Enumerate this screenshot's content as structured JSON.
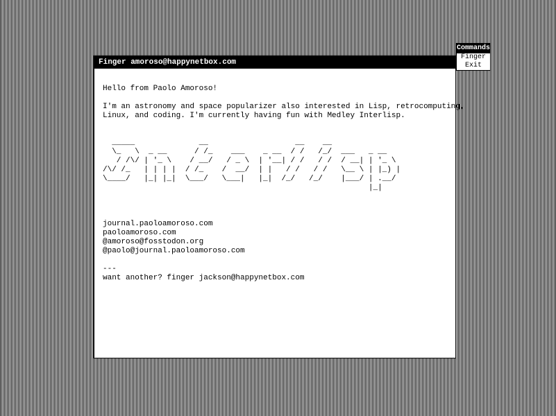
{
  "main": {
    "title": "Finger amoroso@happynetbox.com",
    "greeting": "Hello from Paolo Amoroso!",
    "intro": "I'm an astronomy and space popularizer also interested in Lisp, retrocomputing,\nLinux, and coding. I'm currently having fun with Medley Interlisp.",
    "ascii_art": "  _____              __                   __    __\n  \\_   \\  _ __      / /_    ___    _ __  / /   /_/  ___   _ __\n   / /\\/ | '_ \\    / __/   / _ \\  | '__| / /   / /  / __| | '_ \\\n/\\/ /_   | | | |  / /_    /  __/  | |   / /   / /   \\__ \\ | |_) |\n\\____/   |_| |_|  \\___/   \\___|   |_|  /_/   /_/    |___/ | .__/\n                                                          |_|",
    "links": "journal.paoloamoroso.com\npaoloamoroso.com\n@amoroso@fosstodon.org\n@paolo@journal.paoloamoroso.com",
    "footer": "---\nwant another? finger jackson@happynetbox.com"
  },
  "commands": {
    "title": "Commands",
    "items": [
      "Finger",
      "Exit"
    ]
  }
}
